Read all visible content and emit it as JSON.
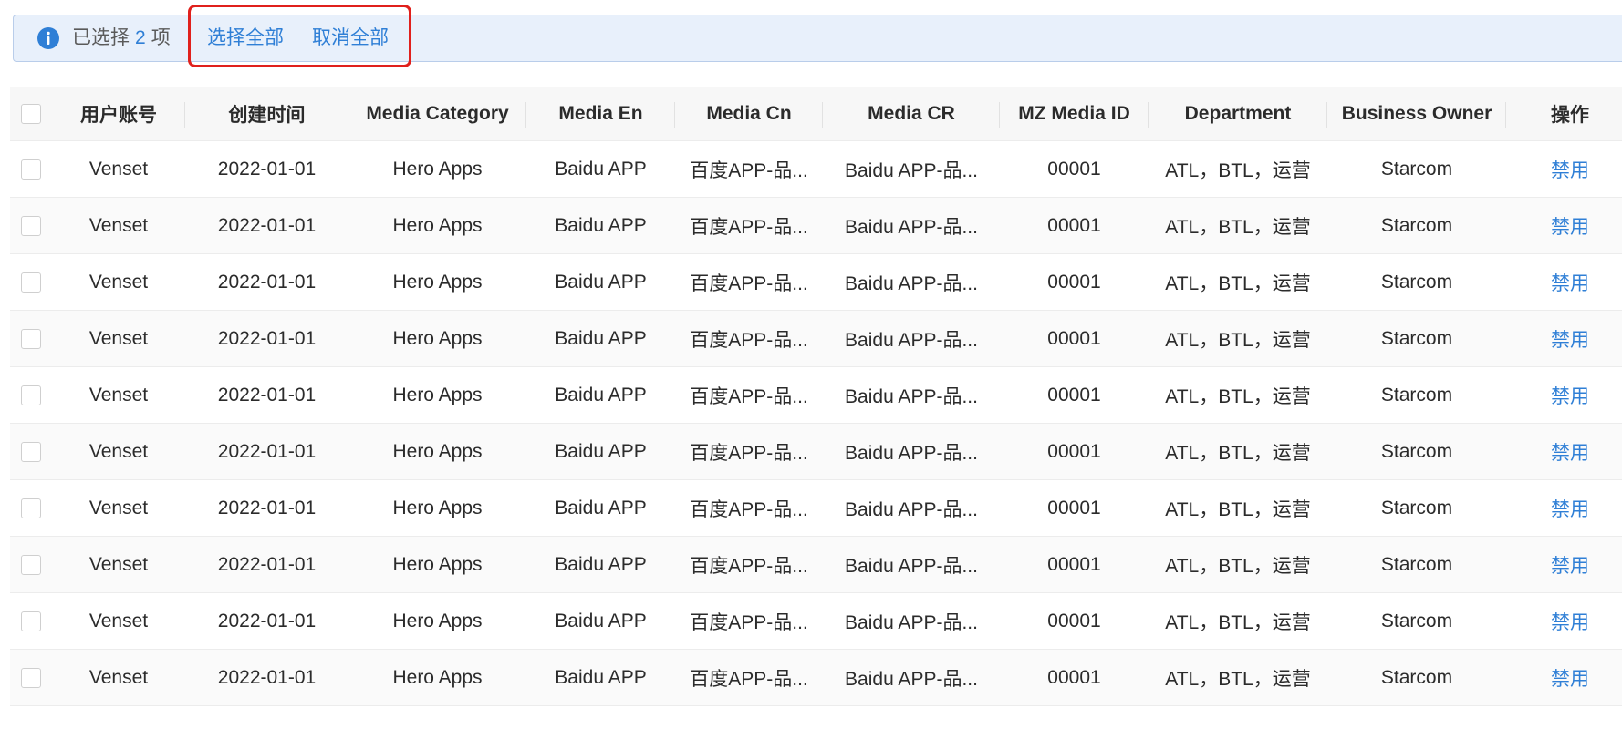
{
  "selection_bar": {
    "prefix": "已选择",
    "count": "2",
    "suffix": "项",
    "select_all_label": "选择全部",
    "deselect_all_label": "取消全部"
  },
  "colors": {
    "accent": "#2f7fd6",
    "alert_bg": "#e8f0fb",
    "highlight": "#e0201c"
  },
  "icons": {
    "info": "info-icon",
    "checkbox": "checkbox"
  },
  "table": {
    "columns": [
      "用户账号",
      "创建时间",
      "Media Category",
      "Media En",
      "Media Cn",
      "Media CR",
      "MZ Media ID",
      "Department",
      "Business Owner",
      "操作"
    ],
    "rows": [
      {
        "account": "Venset",
        "created": "2022-01-01",
        "category": "Hero Apps",
        "media_en": "Baidu APP",
        "media_cn": "百度APP-品...",
        "media_cr": "Baidu APP-品...",
        "mz_id": "00001",
        "department": "ATL，BTL，运营",
        "owner": "Starcom",
        "action": "禁用"
      },
      {
        "account": "Venset",
        "created": "2022-01-01",
        "category": "Hero Apps",
        "media_en": "Baidu APP",
        "media_cn": "百度APP-品...",
        "media_cr": "Baidu APP-品...",
        "mz_id": "00001",
        "department": "ATL，BTL，运营",
        "owner": "Starcom",
        "action": "禁用"
      },
      {
        "account": "Venset",
        "created": "2022-01-01",
        "category": "Hero Apps",
        "media_en": "Baidu APP",
        "media_cn": "百度APP-品...",
        "media_cr": "Baidu APP-品...",
        "mz_id": "00001",
        "department": "ATL，BTL，运营",
        "owner": "Starcom",
        "action": "禁用"
      },
      {
        "account": "Venset",
        "created": "2022-01-01",
        "category": "Hero Apps",
        "media_en": "Baidu APP",
        "media_cn": "百度APP-品...",
        "media_cr": "Baidu APP-品...",
        "mz_id": "00001",
        "department": "ATL，BTL，运营",
        "owner": "Starcom",
        "action": "禁用"
      },
      {
        "account": "Venset",
        "created": "2022-01-01",
        "category": "Hero Apps",
        "media_en": "Baidu APP",
        "media_cn": "百度APP-品...",
        "media_cr": "Baidu APP-品...",
        "mz_id": "00001",
        "department": "ATL，BTL，运营",
        "owner": "Starcom",
        "action": "禁用"
      },
      {
        "account": "Venset",
        "created": "2022-01-01",
        "category": "Hero Apps",
        "media_en": "Baidu APP",
        "media_cn": "百度APP-品...",
        "media_cr": "Baidu APP-品...",
        "mz_id": "00001",
        "department": "ATL，BTL，运营",
        "owner": "Starcom",
        "action": "禁用"
      },
      {
        "account": "Venset",
        "created": "2022-01-01",
        "category": "Hero Apps",
        "media_en": "Baidu APP",
        "media_cn": "百度APP-品...",
        "media_cr": "Baidu APP-品...",
        "mz_id": "00001",
        "department": "ATL，BTL，运营",
        "owner": "Starcom",
        "action": "禁用"
      },
      {
        "account": "Venset",
        "created": "2022-01-01",
        "category": "Hero Apps",
        "media_en": "Baidu APP",
        "media_cn": "百度APP-品...",
        "media_cr": "Baidu APP-品...",
        "mz_id": "00001",
        "department": "ATL，BTL，运营",
        "owner": "Starcom",
        "action": "禁用"
      },
      {
        "account": "Venset",
        "created": "2022-01-01",
        "category": "Hero Apps",
        "media_en": "Baidu APP",
        "media_cn": "百度APP-品...",
        "media_cr": "Baidu APP-品...",
        "mz_id": "00001",
        "department": "ATL，BTL，运营",
        "owner": "Starcom",
        "action": "禁用"
      },
      {
        "account": "Venset",
        "created": "2022-01-01",
        "category": "Hero Apps",
        "media_en": "Baidu APP",
        "media_cn": "百度APP-品...",
        "media_cr": "Baidu APP-品...",
        "mz_id": "00001",
        "department": "ATL，BTL，运营",
        "owner": "Starcom",
        "action": "禁用"
      }
    ]
  }
}
